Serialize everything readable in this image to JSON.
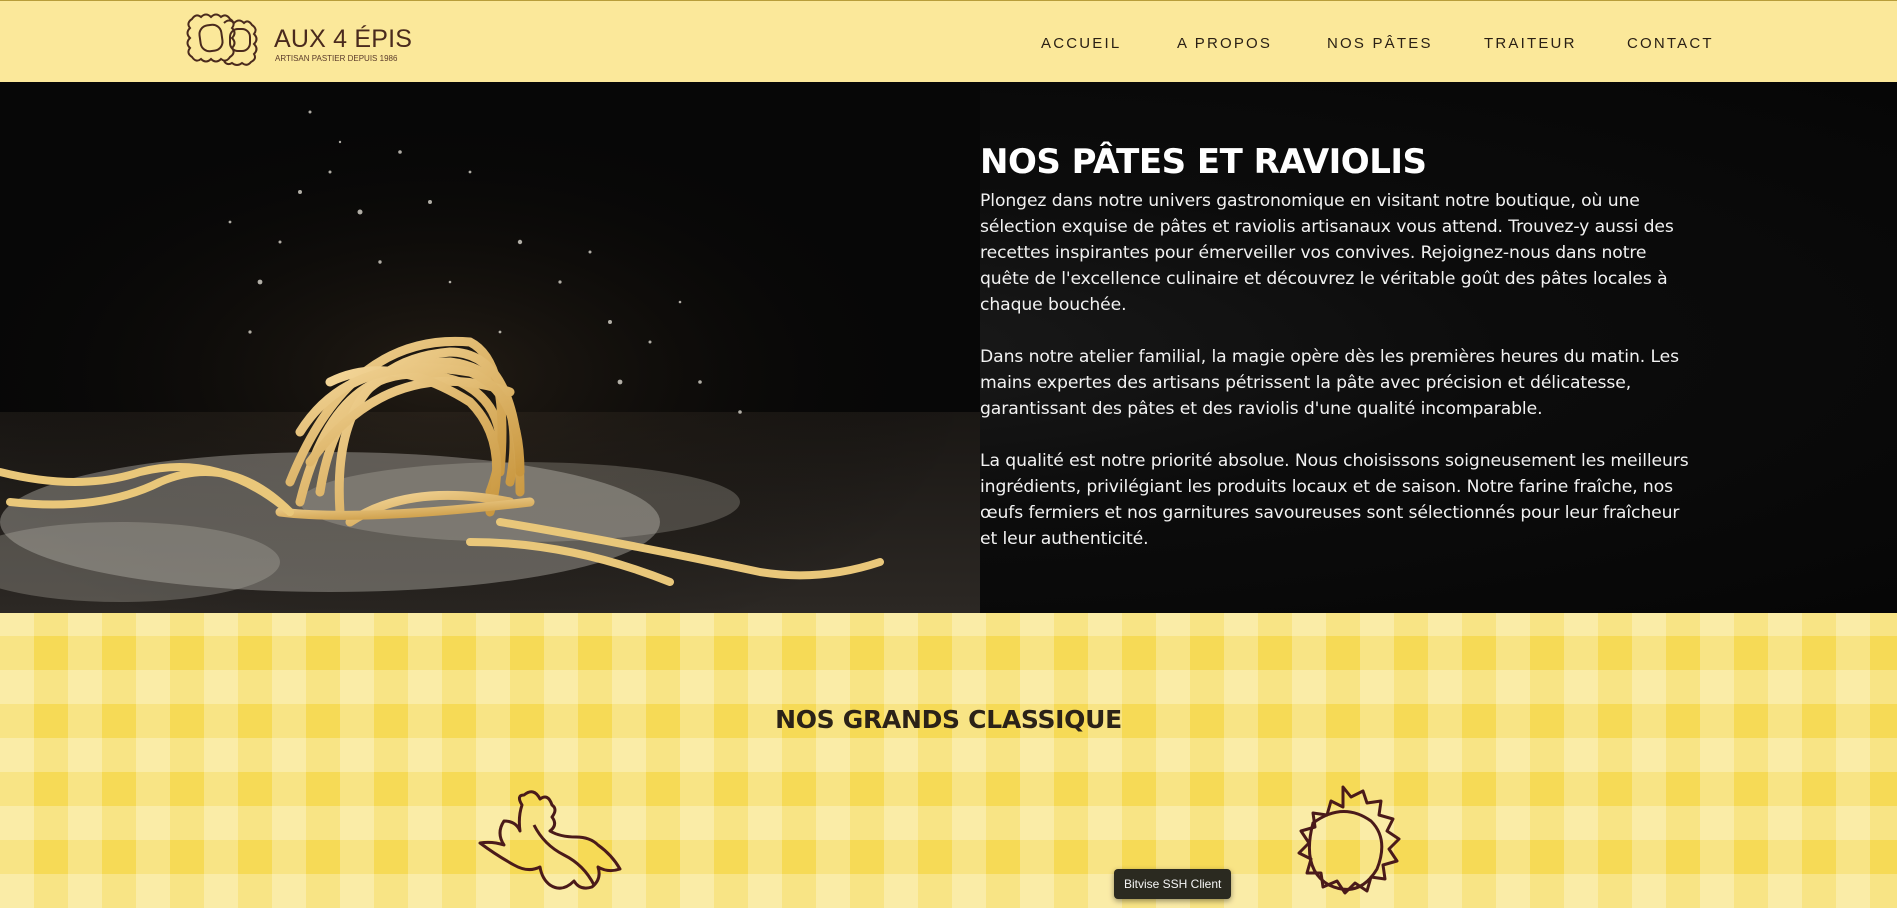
{
  "header": {
    "logo_title": "AUX 4 ÉPIS",
    "logo_subtitle": "ARTISAN PASTIER DEPUIS 1986",
    "nav": [
      "ACCUEIL",
      "A PROPOS",
      "NOS PÂTES",
      "TRAITEUR",
      "CONTACT"
    ]
  },
  "hero": {
    "title": "NOS PÂTES ET RAVIOLIS",
    "paragraphs": [
      "Plongez dans notre univers gastronomique en visitant notre boutique, où une sélection exquise de pâtes et raviolis artisanaux vous attend. Trouvez-y aussi des recettes inspirantes pour émerveiller vos convives. Rejoignez-nous dans notre quête de l'excellence culinaire et découvrez le véritable goût des pâtes locales à chaque bouchée.",
      "Dans notre atelier familial, la magie opère dès les premières heures du matin. Les mains expertes des artisans pétrissent la pâte avec précision et délicatesse, garantissant des pâtes et des raviolis d'une qualité incomparable.",
      "La qualité est notre priorité absolue. Nous choisissons soigneusement les meilleurs ingrédients, privilégiant les produits locaux et de saison. Notre farine fraîche, nos œufs fermiers et nos garnitures savoureuses sont sélectionnés pour leur fraîcheur et leur authenticité."
    ]
  },
  "classics": {
    "title": "NOS GRANDS CLASSIQUE"
  },
  "tooltip": {
    "text": "Bitvise SSH Client"
  },
  "colors": {
    "header_bg": "#fbe89a",
    "brown": "#4a2a1d",
    "gingham": "#f6da56",
    "icon_stroke": "#4a1a1a"
  },
  "icons": [
    "ravioli-logo-icon",
    "farfalle-icon",
    "ravioli-icon"
  ]
}
